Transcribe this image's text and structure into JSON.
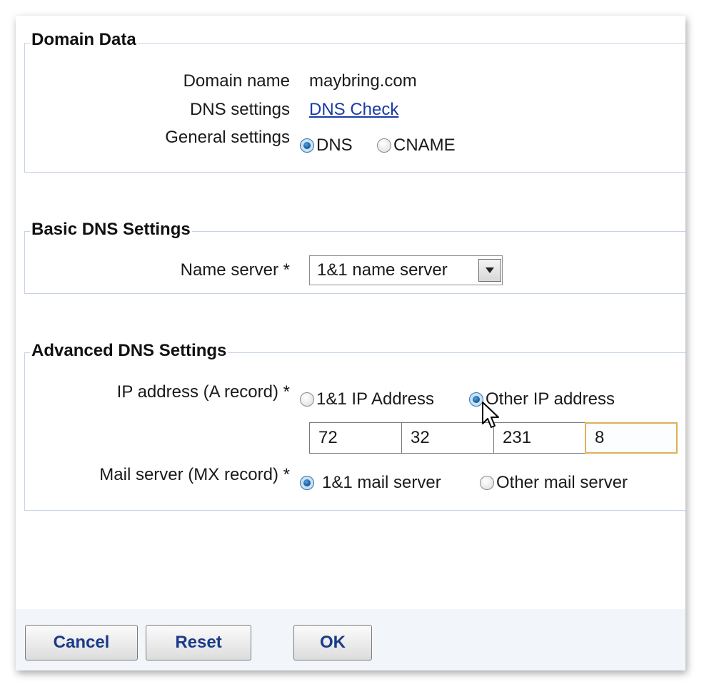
{
  "domain_data": {
    "legend": "Domain Data",
    "domain_name_label": "Domain name",
    "domain_name_value": "maybring.com",
    "dns_settings_label": "DNS settings",
    "dns_check_link": "DNS Check",
    "general_settings_label": "General settings",
    "general_options": [
      {
        "label": "DNS",
        "checked": true
      },
      {
        "label": "CNAME",
        "checked": false
      }
    ]
  },
  "basic_dns": {
    "legend": "Basic DNS Settings",
    "name_server_label": "Name server *",
    "name_server_selected": "1&1 name server"
  },
  "advanced_dns": {
    "legend": "Advanced DNS Settings",
    "ip_label": "IP address (A record) *",
    "ip_options": [
      {
        "label": "1&1 IP Address",
        "checked": false
      },
      {
        "label": "Other IP address",
        "checked": true
      }
    ],
    "ip_octets": [
      "72",
      "32",
      "231",
      "8"
    ],
    "mail_label": "Mail server (MX record) *",
    "mail_options": [
      {
        "label": "1&1 mail server",
        "checked": true
      },
      {
        "label": "Other mail server",
        "checked": false
      }
    ]
  },
  "buttons": {
    "cancel": "Cancel",
    "reset": "Reset",
    "ok": "OK"
  },
  "colors": {
    "link": "#1a3aa8",
    "button_text": "#1a3a8a",
    "section_border": "#c5d3e6",
    "focused_input_border": "#e0b056",
    "footer_bg": "#f2f6fb"
  }
}
